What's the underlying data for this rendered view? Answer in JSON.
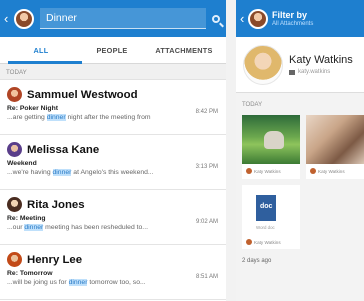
{
  "left": {
    "search_value": "Dinner",
    "tabs": [
      "ALL",
      "PEOPLE",
      "ATTACHMENTS"
    ],
    "section": "TODAY",
    "messages": [
      {
        "name": "Sammuel Westwood",
        "subject": "Re: Poker Night",
        "time": "8:42 PM",
        "before": "...are getting ",
        "hl": "dinner",
        "after": " night after the meeting from"
      },
      {
        "name": "Melissa Kane",
        "subject": "Weekend",
        "time": "3:13 PM",
        "before": "...we're having ",
        "hl": "dinner",
        "after": " at Angelo's this weekend..."
      },
      {
        "name": "Rita Jones",
        "subject": "Re: Meeting",
        "time": "9:02 AM",
        "before": "...our ",
        "hl": "dinner",
        "after": " meeting has been resheduled to..."
      },
      {
        "name": "Henry Lee",
        "subject": "Re: Tomorrow",
        "time": "8:51 AM",
        "before": "...will be joing us for ",
        "hl": "dinner",
        "after": " tomorrow too, so..."
      }
    ]
  },
  "right": {
    "title": "Filter by",
    "subtitle": "All Attachments",
    "profile_name": "Katy Watkins",
    "profile_email": "katy.watkins",
    "section": "TODAY",
    "photo_captions": [
      "Katy Watkins",
      "Katy Watkins"
    ],
    "doc_name": "Word doc",
    "doc_badge": "doc",
    "doc_caption": "Katy Watkins",
    "ago": "2 days ago"
  },
  "colors": {
    "accent": "#1e7fcf",
    "highlight": "#bfe0fb"
  }
}
